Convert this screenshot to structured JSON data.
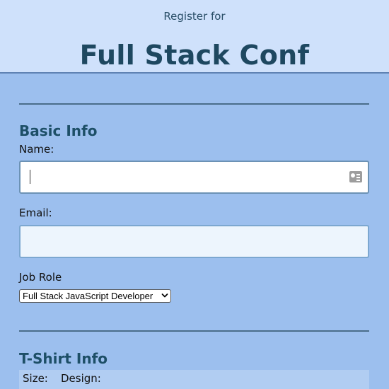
{
  "header": {
    "subtitle": "Register for",
    "title": "Full Stack Conf"
  },
  "basic_info": {
    "title": "Basic Info",
    "name_label": "Name:",
    "email_label": "Email:",
    "job_role_label": "Job Role",
    "job_role_selected": "Full Stack JavaScript Developer"
  },
  "tshirt_info": {
    "title": "T-Shirt Info",
    "size_label": "Size:",
    "design_label": "Design:"
  },
  "inputs": {
    "name_value": "",
    "email_value": ""
  },
  "icons": {
    "name_field_icon": "contact-card-icon",
    "select_icon": "chevron-down-icon"
  },
  "colors": {
    "header_background": "#cfe1fb",
    "page_background": "#9cbfee",
    "heading_text": "#1d4f67"
  }
}
